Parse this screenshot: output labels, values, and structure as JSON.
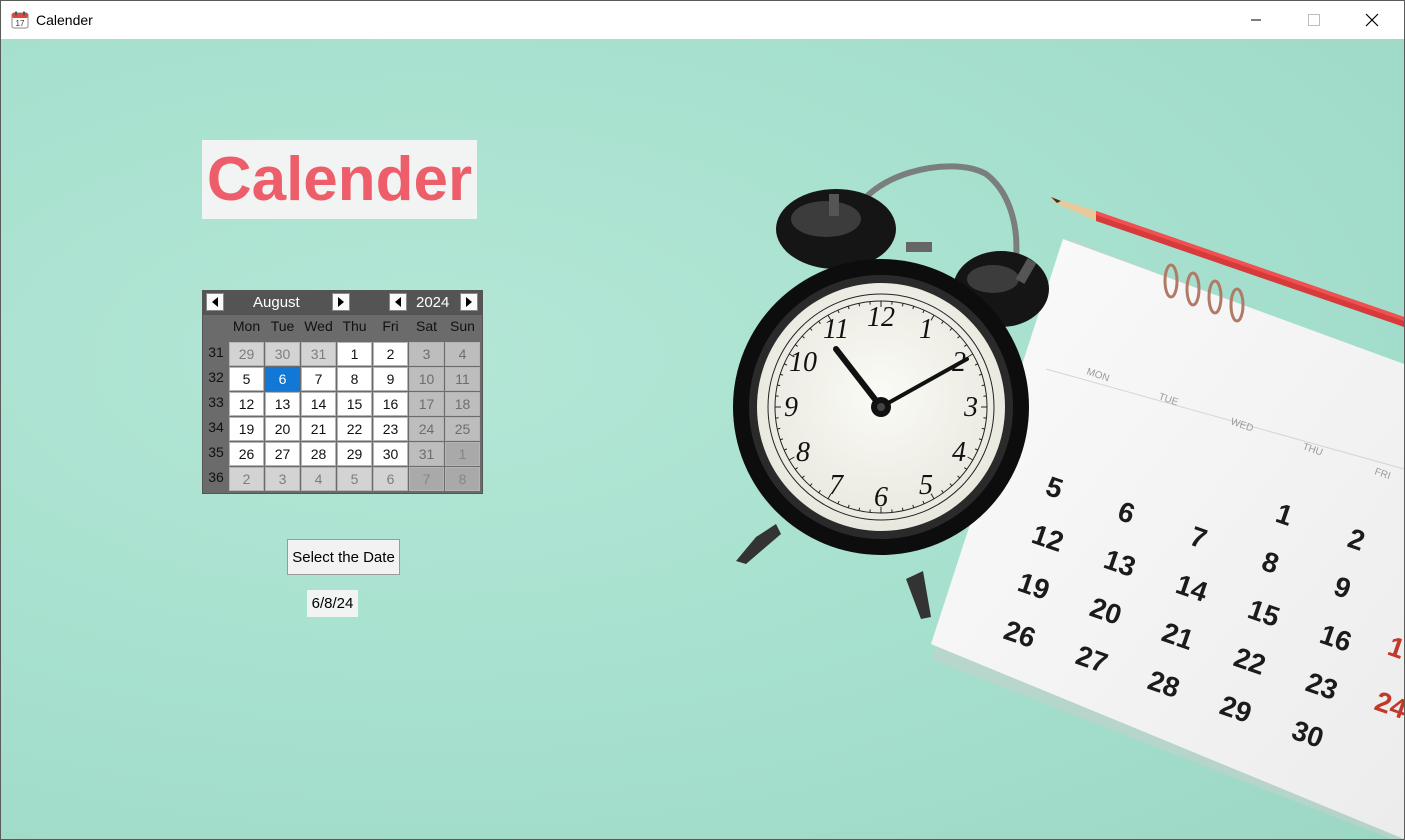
{
  "window": {
    "title": "Calender",
    "icon": "calendar-app-icon",
    "controls": [
      "minimize-icon",
      "maximize-icon",
      "close-icon"
    ]
  },
  "heading": {
    "text": "Calender",
    "color": "#ee5e6a"
  },
  "calendar": {
    "month": "August",
    "year": "2024",
    "weekdays": [
      "Mon",
      "Tue",
      "Wed",
      "Thu",
      "Fri",
      "Sat",
      "Sun"
    ],
    "weeks": [
      {
        "number": "31",
        "days": [
          {
            "d": "29",
            "type": "other"
          },
          {
            "d": "30",
            "type": "other"
          },
          {
            "d": "31",
            "type": "other"
          },
          {
            "d": "1",
            "type": "normal"
          },
          {
            "d": "2",
            "type": "normal"
          },
          {
            "d": "3",
            "type": "weekend"
          },
          {
            "d": "4",
            "type": "weekend"
          }
        ]
      },
      {
        "number": "32",
        "days": [
          {
            "d": "5",
            "type": "normal"
          },
          {
            "d": "6",
            "type": "selected"
          },
          {
            "d": "7",
            "type": "normal"
          },
          {
            "d": "8",
            "type": "normal"
          },
          {
            "d": "9",
            "type": "normal"
          },
          {
            "d": "10",
            "type": "weekend"
          },
          {
            "d": "11",
            "type": "weekend"
          }
        ]
      },
      {
        "number": "33",
        "days": [
          {
            "d": "12",
            "type": "normal"
          },
          {
            "d": "13",
            "type": "normal"
          },
          {
            "d": "14",
            "type": "normal"
          },
          {
            "d": "15",
            "type": "normal"
          },
          {
            "d": "16",
            "type": "normal"
          },
          {
            "d": "17",
            "type": "weekend"
          },
          {
            "d": "18",
            "type": "weekend"
          }
        ]
      },
      {
        "number": "34",
        "days": [
          {
            "d": "19",
            "type": "normal"
          },
          {
            "d": "20",
            "type": "normal"
          },
          {
            "d": "21",
            "type": "normal"
          },
          {
            "d": "22",
            "type": "normal"
          },
          {
            "d": "23",
            "type": "normal"
          },
          {
            "d": "24",
            "type": "weekend"
          },
          {
            "d": "25",
            "type": "weekend"
          }
        ]
      },
      {
        "number": "35",
        "days": [
          {
            "d": "26",
            "type": "normal"
          },
          {
            "d": "27",
            "type": "normal"
          },
          {
            "d": "28",
            "type": "normal"
          },
          {
            "d": "29",
            "type": "normal"
          },
          {
            "d": "30",
            "type": "normal"
          },
          {
            "d": "31",
            "type": "weekend"
          },
          {
            "d": "1",
            "type": "weekend-other"
          }
        ]
      },
      {
        "number": "36",
        "days": [
          {
            "d": "2",
            "type": "other"
          },
          {
            "d": "3",
            "type": "other"
          },
          {
            "d": "4",
            "type": "other"
          },
          {
            "d": "5",
            "type": "other"
          },
          {
            "d": "6",
            "type": "other"
          },
          {
            "d": "7",
            "type": "weekend-other"
          },
          {
            "d": "8",
            "type": "weekend-other"
          }
        ]
      }
    ],
    "selected_color": "#1377d6"
  },
  "select_button": {
    "label": "Select the Date"
  },
  "result": {
    "value": "6/8/24"
  },
  "photo": {
    "clock_numerals": [
      "12",
      "1",
      "2",
      "3",
      "4",
      "5",
      "6",
      "7",
      "8",
      "9",
      "10",
      "11"
    ],
    "paper_weekdays": [
      "MON",
      "TUE",
      "WED",
      "THU",
      "FRI"
    ],
    "paper_rows": [
      [
        "",
        "",
        "",
        "1",
        "2"
      ],
      [
        "5",
        "6",
        "7",
        "8",
        "9"
      ],
      [
        "12",
        "13",
        "14",
        "15",
        "16"
      ],
      [
        "19",
        "20",
        "21",
        "22",
        "23"
      ],
      [
        "26",
        "27",
        "28",
        "29",
        "30"
      ]
    ],
    "paper_red": [
      "1",
      "24"
    ]
  }
}
